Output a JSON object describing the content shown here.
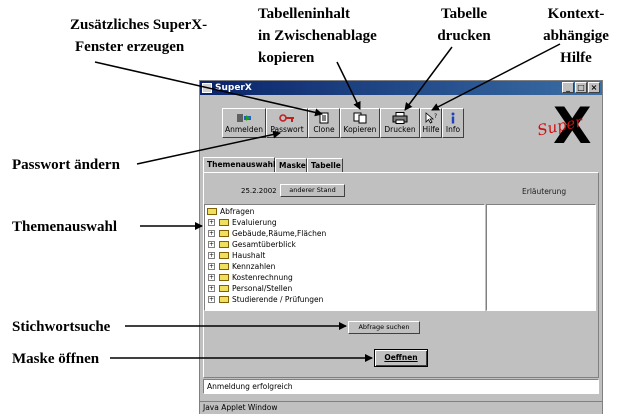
{
  "annotations": {
    "zusaetzliches_line1": "Zusätzliches SuperX-",
    "zusaetzliches_line2": "Fenster erzeugen",
    "tabelleninhalt_line1": "Tabelleninhalt",
    "tabelleninhalt_line2": "in Zwischenablage",
    "tabelleninhalt_line3": "kopieren",
    "drucken_line1": "Tabelle",
    "drucken_line2": "drucken",
    "hilfe_line1": "Kontext-",
    "hilfe_line2": "abhängige",
    "hilfe_line3": "Hilfe",
    "passwort": "Passwort ändern",
    "themenauswahl": "Themenauswahl",
    "stichwortsuche": "Stichwortsuche",
    "maske": "Maske öffnen"
  },
  "window": {
    "title": "SuperX",
    "min_glyph": "_",
    "max_glyph": "□",
    "close_glyph": "×"
  },
  "toolbar": {
    "anmelden": "Anmelden",
    "passwort": "Passwort",
    "clone": "Clone",
    "kopieren": "Kopieren",
    "drucken": "Drucken",
    "hilfe": "Hilfe",
    "info": "Info"
  },
  "logo": {
    "super": "Super",
    "x": "X"
  },
  "tabs": [
    "Themenauswahl",
    "Maske",
    "Tabelle"
  ],
  "stand": {
    "date": "25.2.2002",
    "button": "anderer Stand"
  },
  "erlaeuterung": "Erläuterung",
  "tree": {
    "root": "Abfragen",
    "items": [
      "Evaluierung",
      "Gebäude,Räume,Flächen",
      "Gesamtüberblick",
      "Haushalt",
      "Kennzahlen",
      "Kostenrechnung",
      "Personal/Stellen",
      "Studierende / Prüfungen"
    ],
    "expand_glyph": "+"
  },
  "search_button": "Abfrage suchen",
  "open_button": "Oeffnen",
  "status": "Anmeldung erfolgreich",
  "footer": "Java Applet Window",
  "colors": {
    "titlebar": "#0a246a",
    "window_bg": "#c0c0c0",
    "logo_red": "#d01010"
  }
}
